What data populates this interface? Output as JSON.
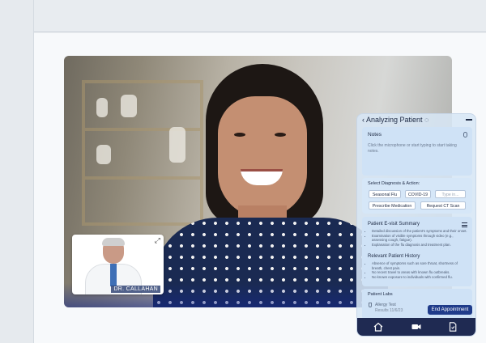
{
  "video": {
    "remote_participant": "patient",
    "local_participant_label": "DR. CALLAHAN"
  },
  "panel": {
    "title": "Analyzing Patient",
    "notes": {
      "heading": "Notes",
      "placeholder": "Click the microphone or start typing to start taking notes."
    },
    "diagnosis": {
      "heading": "Select Diagnosis & Action:",
      "chips": [
        "Seasonal Flu",
        "COVID-19",
        "Prescribe Medication",
        "Request CT Scan"
      ],
      "input_placeholder": "Type in..."
    },
    "summary": {
      "heading": "Patient E-visit Summary",
      "bullets": [
        "Detailed discussion of the patient's symptoms and their onset.",
        "Examination of visible symptoms through video (e.g., assessing cough, fatigue).",
        "Explanation of the flu diagnosis and treatment plan."
      ]
    },
    "history": {
      "heading": "Relevant Patient History",
      "bullets": [
        "Absence of symptoms such as sore throat, shortness of breath, chest pain.",
        "No recent travel to areas with known flu outbreaks.",
        "No known exposure to individuals with confirmed flu."
      ]
    },
    "labs": {
      "heading": "Patient Labs",
      "items": [
        {
          "name": "Allergy Test",
          "date": "Results 11/6/23"
        }
      ]
    },
    "end_button": "End Appointment",
    "nav": [
      "home-icon",
      "video-camera-icon",
      "document-icon"
    ]
  },
  "colors": {
    "accent": "#1f3b8a",
    "panel_bg": "#d7e6f5",
    "card_bg": "#cfe2f6"
  }
}
